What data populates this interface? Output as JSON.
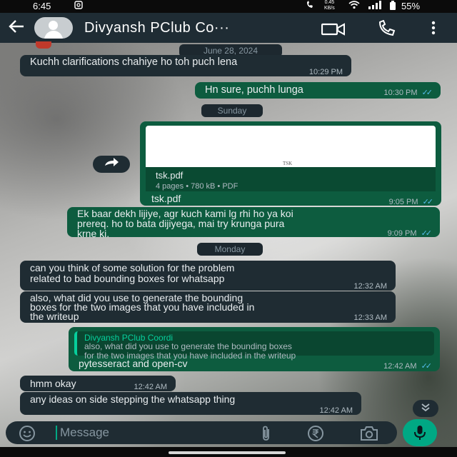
{
  "status_bar": {
    "time": "6:45",
    "speed_value": "0.45",
    "speed_unit": "KB/s",
    "battery": "55%"
  },
  "header": {
    "contact_name": "Divyansh PClub Co···"
  },
  "dates": {
    "first": "June 28, 2024",
    "second": "Sunday",
    "third": "Monday"
  },
  "messages": [
    {
      "direction": "in",
      "text": "Kuchh clarifications chahiye ho toh puch lena",
      "time": "10:29 PM"
    },
    {
      "direction": "out",
      "text": "Hn sure, puchh lunga",
      "time": "10:30 PM"
    },
    {
      "direction": "out",
      "type": "document",
      "preview_title": "TSK",
      "file_name": "tsk.pdf",
      "file_meta": "4 pages • 780 kB • PDF",
      "caption": "tsk.pdf",
      "time": "9:05 PM"
    },
    {
      "direction": "out",
      "text": "Ek baar dekh lijiye, agr kuch kami lg rhi ho ya koi\nprereq. ho to bata dijiyega, mai try krunga pura\nkrne ki.",
      "time": "9:09 PM"
    },
    {
      "direction": "in",
      "text": "can you think of some solution for the problem\nrelated to bad bounding boxes for whatsapp",
      "time": "12:32 AM"
    },
    {
      "direction": "in",
      "text": "also, what did you use to generate the bounding\nboxes for the two images that you have included in\nthe writeup",
      "time": "12:33 AM"
    },
    {
      "direction": "out",
      "quote_name": "Divyansh PClub Coordi",
      "quote_text": "also, what did you use to generate the bounding boxes\nfor the two images that you have included in the writeup",
      "text": "pytesseract and open-cv",
      "time": "12:42 AM"
    },
    {
      "direction": "in",
      "text": "hmm okay",
      "time": "12:42 AM"
    },
    {
      "direction": "in",
      "text": "any ideas on side stepping the whatsapp thing",
      "time": "12:42 AM"
    }
  ],
  "composer": {
    "placeholder": "Message"
  },
  "colors": {
    "header": "#1f2c34",
    "incoming_bubble": "#1f2c33",
    "outgoing_bubble": "#0d5c3f",
    "accent": "#00a884",
    "read_ticks": "#53bdeb"
  },
  "icons": [
    "back-arrow-icon",
    "video-call-icon",
    "phone-icon",
    "more-vert-icon",
    "forward-icon",
    "chevron-double-down-icon",
    "emoji-icon",
    "attach-icon",
    "rupee-icon",
    "camera-icon",
    "mic-icon"
  ]
}
